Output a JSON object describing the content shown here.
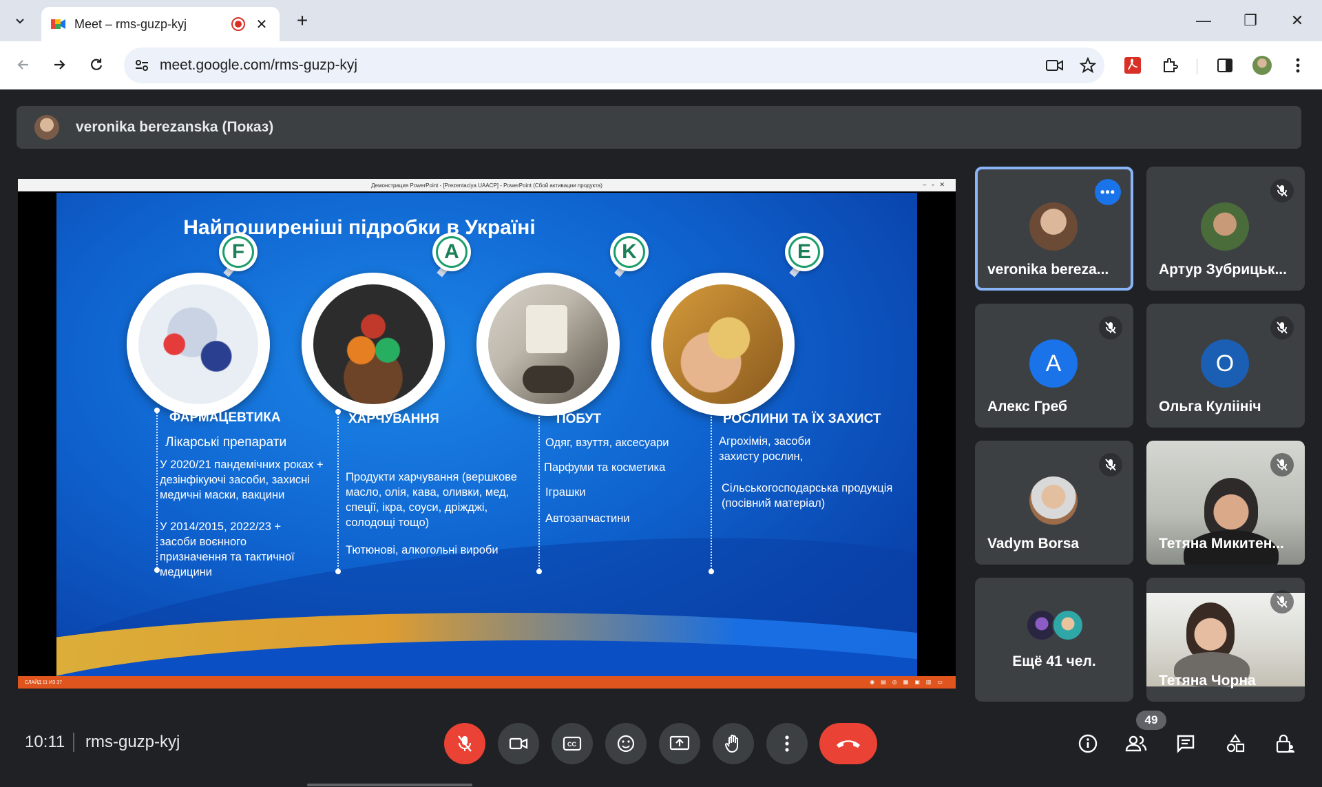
{
  "browser": {
    "tab_title": "Meet – rms-guzp-kyj",
    "tab_close": "✕",
    "new_tab": "+",
    "url": "meet.google.com/rms-guzp-kyj",
    "window_minimize": "—",
    "window_restore": "❐",
    "window_close": "✕"
  },
  "presenter": {
    "label": "veronika berezanska (Показ)"
  },
  "screen_share": {
    "app_titlebar": "Демонстрация PowerPoint - [Prezentaciya UAACP] - PowerPoint (Сбой активации продукта)",
    "statusbar": "СЛАЙД 11 ИЗ 37",
    "slide": {
      "title": "Найпоширеніші підробки в Україні",
      "categories": [
        {
          "badge": "F",
          "title": "ФАРМАЦЕВТИКА",
          "items": [
            "Лікарські препарати",
            "У 2020/21 пандемічних роках + дезінфікуючі засоби, захисні медичні маски, вакцини",
            "У 2014/2015, 2022/23 + засоби воєнного призначення та тактичної медицини"
          ]
        },
        {
          "badge": "A",
          "title": "ХАРЧУВАННЯ",
          "items": [
            "Продукти харчування (вершкове масло, олія, кава, оливки, мед, спеції, ікра, соуси, дріжджі, солодощі тощо)",
            "Тютюнові, алкогольні вироби"
          ]
        },
        {
          "badge": "K",
          "title": "ПОБУТ",
          "items": [
            "Одяг, взуття, аксесуари",
            "Парфуми та косметика",
            "Іграшки",
            "Автозапчастини"
          ]
        },
        {
          "badge": "E",
          "title": "РОСЛИНИ ТА ЇХ ЗАХИСТ",
          "items": [
            "Агрохімія, засоби захисту рослин,",
            "Сільськогосподарська продукція (посівний матеріал)"
          ]
        }
      ]
    }
  },
  "participants": [
    {
      "name": "veronika bereza...",
      "active": true
    },
    {
      "name": "Артур Зубрицьк...",
      "muted": true
    },
    {
      "name": "Алекс Греб",
      "initial": "А",
      "color": "#1a73e8",
      "muted": true
    },
    {
      "name": "Ольга Куліініч",
      "initial": "О",
      "color": "#1a5fb4",
      "muted": true
    },
    {
      "name": "Vadym Borsa",
      "muted": true
    },
    {
      "name": "Тетяна Микитен...",
      "muted": true
    },
    {
      "name": "Ещё 41 чел."
    },
    {
      "name": "Тетяна Чорна",
      "muted": true
    }
  ],
  "bottom_bar": {
    "time": "10:11",
    "meeting_code": "rms-guzp-kyj",
    "people_count": "49"
  }
}
